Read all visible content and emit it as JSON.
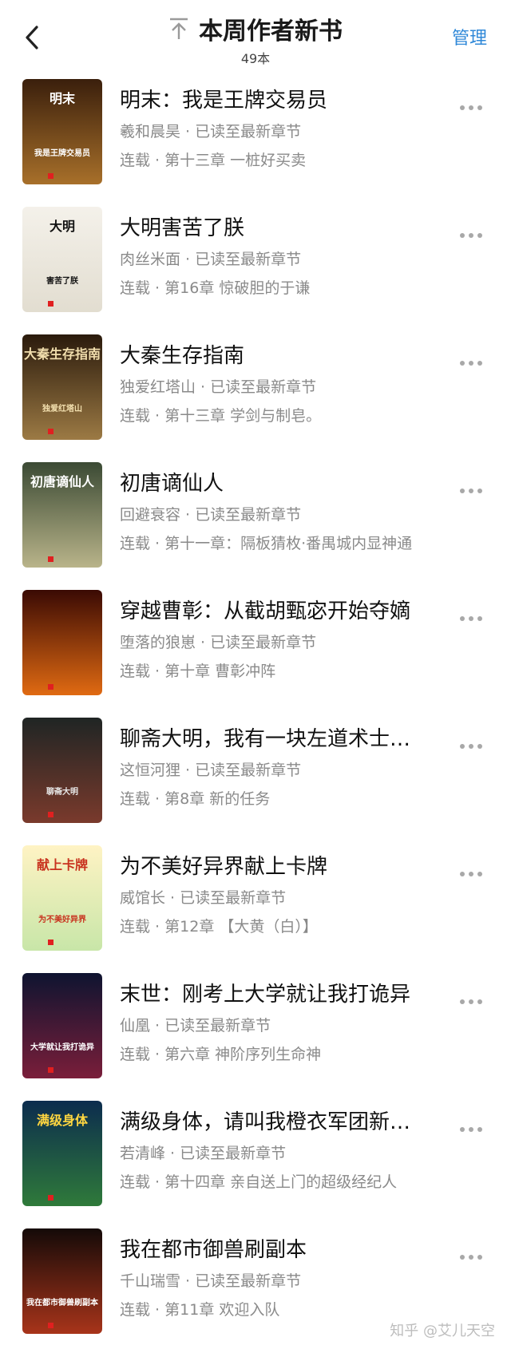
{
  "header": {
    "title": "本周作者新书",
    "count": "49本",
    "manage": "管理"
  },
  "colors": {
    "accent": "#2f88d8",
    "secondary_text": "#8a8a8a"
  },
  "books": [
    {
      "title": "明末：我是王牌交易员",
      "author": "羲和晨昊",
      "status": "已读至最新章节",
      "serial": "连载",
      "chapter": "第十三章 一桩好买卖",
      "cover_text": "明末",
      "cover_sub": "我是王牌交易员",
      "cover_bg1": "#3a1f0c",
      "cover_bg2": "#a8702a",
      "cover_fg": "#ffffff"
    },
    {
      "title": "大明害苦了朕",
      "author": "肉丝米面",
      "status": "已读至最新章节",
      "serial": "连载",
      "chapter": "第16章 惊破胆的于谦",
      "cover_text": "大明",
      "cover_sub": "害苦了朕",
      "cover_bg1": "#f4f1ea",
      "cover_bg2": "#e2ddd0",
      "cover_fg": "#111111"
    },
    {
      "title": "大秦生存指南",
      "author": "独爱红塔山",
      "status": "已读至最新章节",
      "serial": "连载",
      "chapter": "第十三章 学剑与制皂。",
      "cover_text": "大秦生存指南",
      "cover_sub": "独爱红塔山",
      "cover_bg1": "#2a1a0c",
      "cover_bg2": "#9c7a44",
      "cover_fg": "#f2dfae"
    },
    {
      "title": "初唐谪仙人",
      "author": "回避衰容",
      "status": "已读至最新章节",
      "serial": "连载",
      "chapter": "第十一章：隔板猜枚·番禺城内显神通",
      "cover_text": "初唐谪仙人",
      "cover_sub": "",
      "cover_bg1": "#3b4a34",
      "cover_bg2": "#b9b48a",
      "cover_fg": "#ffffff"
    },
    {
      "title": "穿越曹彰：从截胡甄宓开始夺嫡",
      "author": "堕落的狼崽",
      "status": "已读至最新章节",
      "serial": "连载",
      "chapter": "第十章 曹彰冲阵",
      "cover_text": "",
      "cover_sub": "",
      "cover_bg1": "#3a0a04",
      "cover_bg2": "#e06a12",
      "cover_fg": "#ffd25a"
    },
    {
      "title": "聊斋大明，我有一块左道术士…",
      "author": "这恒河狸",
      "status": "已读至最新章节",
      "serial": "连载",
      "chapter": "第8章 新的任务",
      "cover_text": "",
      "cover_sub": "聊斋大明",
      "cover_bg1": "#1f2524",
      "cover_bg2": "#7a3a2c",
      "cover_fg": "#e8e8e8"
    },
    {
      "title": "为不美好异界献上卡牌",
      "author": "威馆长",
      "status": "已读至最新章节",
      "serial": "连载",
      "chapter": "第12章 【大黄（白）】",
      "cover_text": "献上卡牌",
      "cover_sub": "为不美好异界",
      "cover_bg1": "#fff3c4",
      "cover_bg2": "#c8e6a8",
      "cover_fg": "#c8321e"
    },
    {
      "title": "末世：刚考上大学就让我打诡异",
      "author": "仙凰",
      "status": "已读至最新章节",
      "serial": "连载",
      "chapter": "第六章 神阶序列生命神",
      "cover_text": "",
      "cover_sub": "大学就让我打诡异",
      "cover_bg1": "#0e1430",
      "cover_bg2": "#7a1e3a",
      "cover_fg": "#ffffff"
    },
    {
      "title": "满级身体，请叫我橙衣军团新…",
      "author": "若清峰",
      "status": "已读至最新章节",
      "serial": "连载",
      "chapter": "第十四章 亲自送上门的超级经纪人",
      "cover_text": "满级身体",
      "cover_sub": "",
      "cover_bg1": "#0c2c4e",
      "cover_bg2": "#2f7a3a",
      "cover_fg": "#ffd640"
    },
    {
      "title": "我在都市御兽刷副本",
      "author": "千山瑞雪",
      "status": "已读至最新章节",
      "serial": "连载",
      "chapter": "第11章 欢迎入队",
      "cover_text": "",
      "cover_sub": "我在都市御兽刷副本",
      "cover_bg1": "#140a08",
      "cover_bg2": "#a8341a",
      "cover_fg": "#ffffff"
    }
  ],
  "footer": {
    "watermark": "知乎 @艾儿天空"
  }
}
